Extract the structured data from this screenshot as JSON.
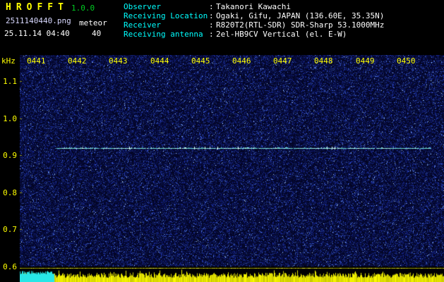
{
  "header": {
    "app_title": "HROFFT",
    "version": "1.0.0",
    "filename": "2511140440.png",
    "mode": "meteor",
    "datetime": "25.11.14 04:40",
    "count": "40"
  },
  "info": {
    "separator": ":",
    "rows": [
      {
        "label": "Observer",
        "value": "Takanori Kawachi"
      },
      {
        "label": "Receiving Location",
        "value": "Ogaki, Gifu, JAPAN (136.60E, 35.35N)"
      },
      {
        "label": "Receiver",
        "value": "R820T2(RTL-SDR) SDR-Sharp 53.1000MHz"
      },
      {
        "label": "Receiving antenna",
        "value": "2el-HB9CV Vertical (el. E-W)"
      }
    ]
  },
  "chart_data": {
    "type": "heatmap",
    "title": "",
    "xlabel": "",
    "ylabel": "kHz",
    "x_ticks": [
      "0441",
      "0442",
      "0443",
      "0444",
      "0445",
      "0446",
      "0447",
      "0448",
      "0449",
      "0450"
    ],
    "y_ticks": [
      "1.1",
      "1.0",
      "0.9",
      "0.8",
      "0.7",
      "0.6"
    ],
    "ylim": [
      0.6,
      1.17
    ],
    "grid": false,
    "series": [
      {
        "name": "carrier-line",
        "freq_khz": 0.92,
        "from_time": "0441",
        "to_time": "0450"
      }
    ],
    "level_strip": {
      "description": "signal-level trace along bottom edge",
      "trace_color": "#dcdc00",
      "highlight_color": "#28e6e6",
      "highlight_span": "left edge (~0440-0441)"
    },
    "colors": {
      "axis_text": "#ffff00",
      "noise_background": "#000520",
      "noise_speckle": "#2a4fbd",
      "carrier": "#9ae6dc",
      "separator_line": "#c8c800"
    }
  }
}
